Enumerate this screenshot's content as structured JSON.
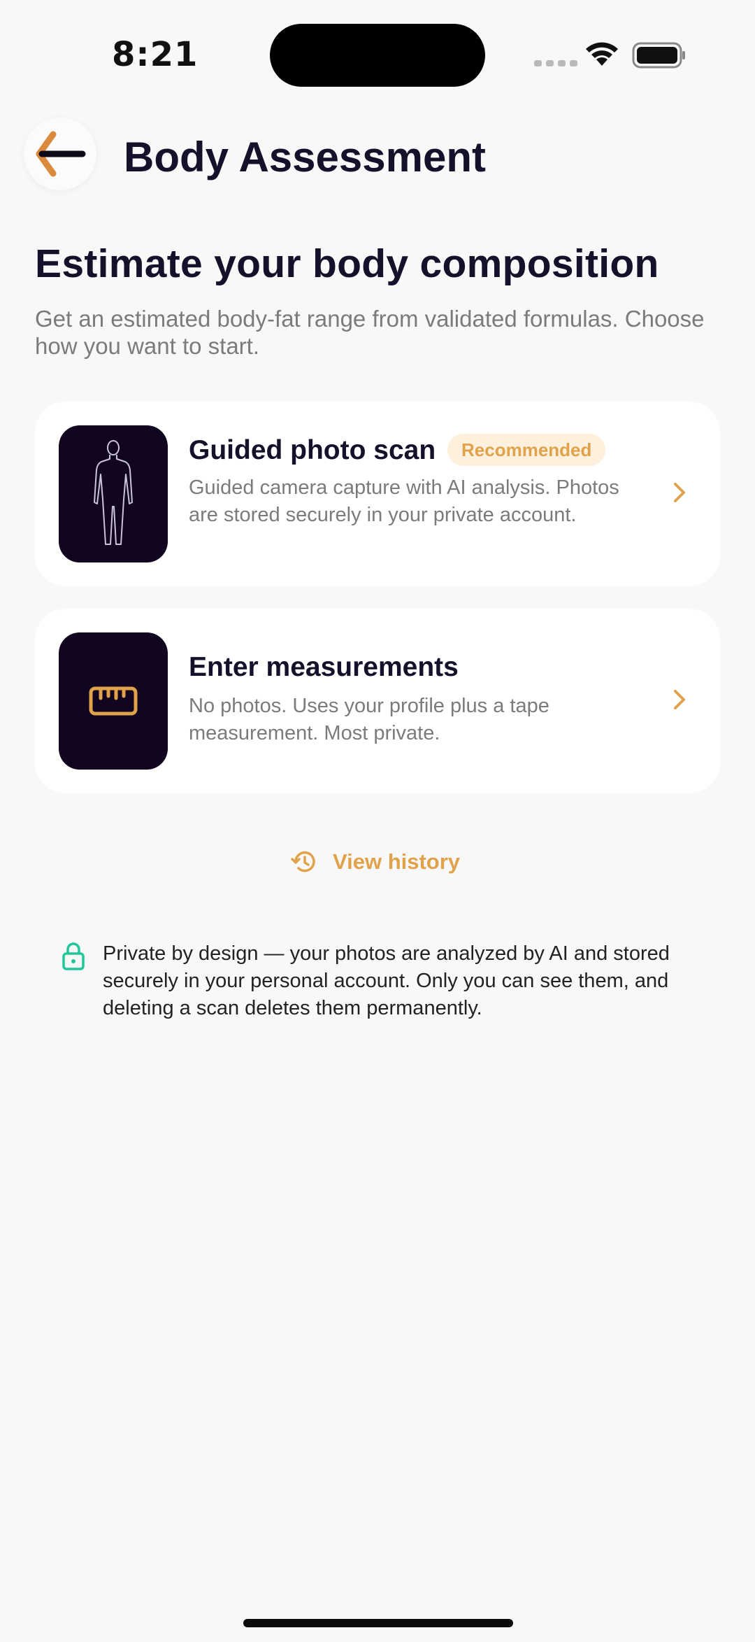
{
  "status_bar": {
    "time": "8:21"
  },
  "header": {
    "title": "Body Assessment",
    "back_icon": "arrow-left-icon"
  },
  "hero": {
    "headline": "Estimate your body composition",
    "subtext": "Get an estimated body-fat range from validated formulas. Choose how you want to start."
  },
  "options": [
    {
      "title": "Guided photo scan",
      "badge": "Recommended",
      "description": "Guided camera capture with AI analysis. Photos are stored securely in your private account.",
      "icon": "body-silhouette-icon"
    },
    {
      "title": "Enter measurements",
      "description": "No photos. Uses your profile plus a tape measurement. Most private.",
      "icon": "ruler-icon"
    }
  ],
  "history": {
    "label": "View history",
    "icon": "history-icon"
  },
  "privacy": {
    "text": "Private by design — your photos are analyzed by AI and stored securely in your personal account. Only you can see them, and deleting a scan deletes them permanently.",
    "icon": "lock-icon"
  },
  "colors": {
    "accent": "#e0a24a",
    "dark_tile": "#12051f",
    "title": "#14112b",
    "muted": "#7b7b7b",
    "privacy_green": "#1fc79b",
    "background": "#f8f8f8"
  }
}
